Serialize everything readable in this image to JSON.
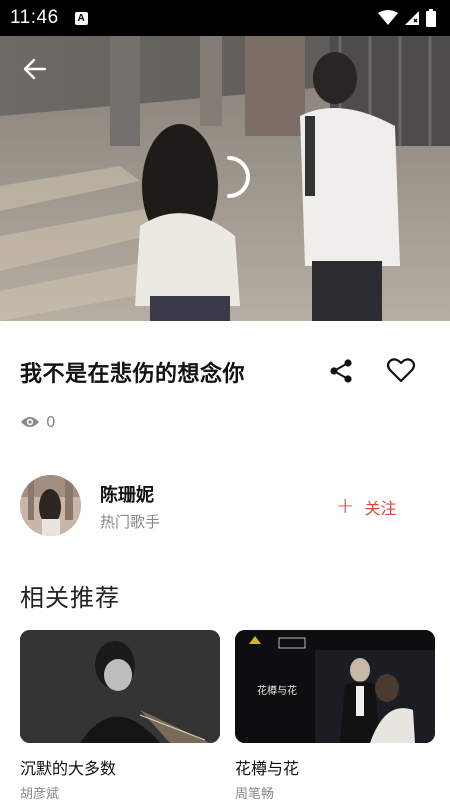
{
  "status_bar": {
    "time": "11:46",
    "notification_letter": "A",
    "icons": [
      "wifi-icon",
      "signal-icon",
      "battery-icon"
    ]
  },
  "video": {
    "back_icon": "arrow-left-icon",
    "loading_icon": "spinner-icon"
  },
  "song": {
    "title": "我不是在悲伤的想念你",
    "share_icon": "share-icon",
    "like_icon": "heart-icon",
    "view_icon": "eye-icon",
    "view_count": "0"
  },
  "artist": {
    "name": "陈珊妮",
    "subtitle": "热门歌手",
    "follow_label": "关注",
    "follow_symbol": "+"
  },
  "recommend": {
    "title": "相关推荐",
    "items": [
      {
        "title": "沉默的大多数",
        "artist": "胡彦斌"
      },
      {
        "title": "花樽与花",
        "artist": "周笔畅",
        "thumb_text": "花樽与花"
      }
    ]
  },
  "colors": {
    "accent": "#e0443c",
    "status_bar": "#000000",
    "muted_text": "#888888"
  }
}
